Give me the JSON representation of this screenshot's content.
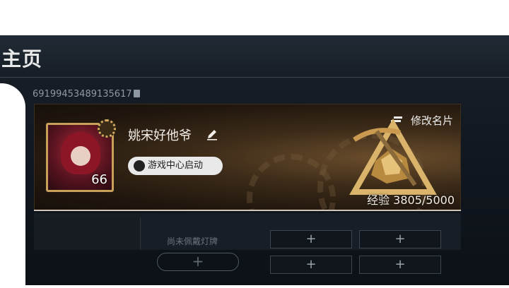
{
  "header": {
    "title": "主页"
  },
  "profile": {
    "player_id": "691994534891356​17",
    "username": "姚宋好他爷",
    "level": "66",
    "launch_button_label": "游戏中心启动",
    "edit_card_label": "修改名片",
    "exp_text": "经验 3805/5000"
  },
  "plates": {
    "empty_label": "尚未佩戴灯牌",
    "add_symbol": "+",
    "slot_symbols": [
      "+",
      "+",
      "+",
      "+"
    ]
  },
  "colors": {
    "accent_gold": "#c9a05a",
    "background": "#121820"
  }
}
